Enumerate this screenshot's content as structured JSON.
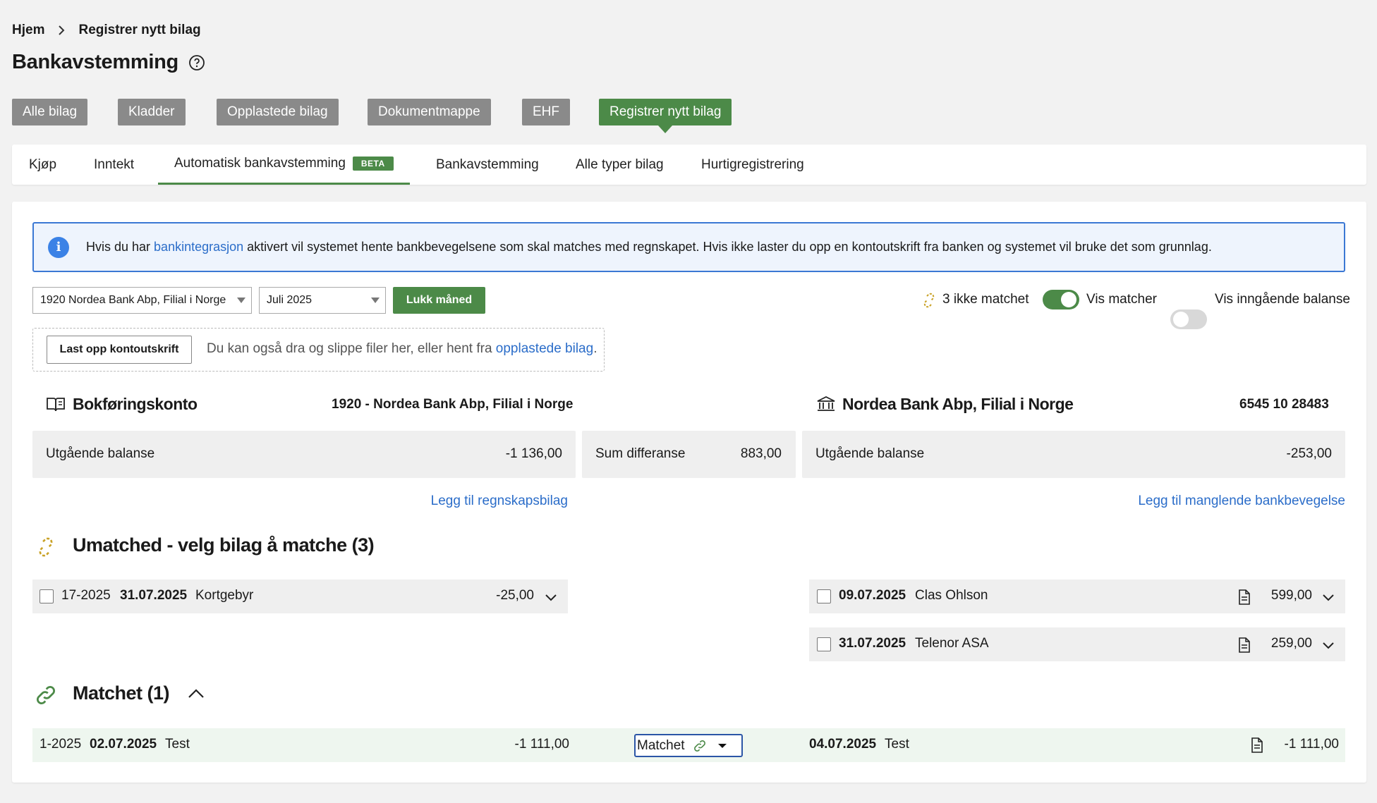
{
  "breadcrumb": {
    "home": "Hjem",
    "current": "Registrer nytt bilag"
  },
  "page_title": "Bankavstemming",
  "topnav": [
    "Alle bilag",
    "Kladder",
    "Opplastede bilag",
    "Dokumentmappe",
    "EHF",
    "Registrer nytt bilag"
  ],
  "tabs": {
    "kjop": "Kjøp",
    "inntekt": "Inntekt",
    "auto": "Automatisk bankavstemming",
    "beta": "BETA",
    "bank": "Bankavstemming",
    "alle": "Alle typer bilag",
    "hurtig": "Hurtigregistrering"
  },
  "info": {
    "before": "Hvis du har ",
    "link": "bankintegrasjon",
    "after": " aktivert vil systemet hente bankbevegelsene som skal matches med regnskapet. Hvis ikke laster du opp en kontoutskrift fra banken og systemet vil bruke det som grunnlag."
  },
  "controls": {
    "account_select": "1920 Nordea Bank Abp, Filial i Norge",
    "month_select": "Juli 2025",
    "close_month": "Lukk måned",
    "unmatched_count": "3 ikke matchet",
    "show_matches": "Vis matcher",
    "show_opening": "Vis inngående balanse"
  },
  "upload": {
    "button": "Last opp kontoutskrift",
    "text": "Du kan også dra og slippe filer her, eller hent fra",
    "link": "opplastede bilag",
    "period": "."
  },
  "ledger": {
    "title": "Bokføringskonto",
    "account": "1920 - Nordea Bank Abp, Filial i Norge",
    "balance_label": "Utgående balanse",
    "balance_value": "-1 136,00",
    "add_link": "Legg til regnskapsbilag"
  },
  "difference": {
    "label": "Sum differanse",
    "value": "883,00"
  },
  "bank": {
    "title": "Nordea Bank Abp, Filial i Norge",
    "account": "6545 10 28483",
    "balance_label": "Utgående balanse",
    "balance_value": "-253,00",
    "add_link": "Legg til manglende bankbevegelse"
  },
  "unmatched": {
    "title": "Umatched - velg bilag å matche (3)",
    "left": [
      {
        "voucher": "17-2025",
        "date": "31.07.2025",
        "text": "Kortgebyr",
        "amount": "-25,00"
      }
    ],
    "right": [
      {
        "date": "09.07.2025",
        "text": "Clas Ohlson",
        "amount": "599,00"
      },
      {
        "date": "31.07.2025",
        "text": "Telenor ASA",
        "amount": "259,00"
      }
    ]
  },
  "matched": {
    "title": "Matchet (1)",
    "rows": [
      {
        "voucher": "1-2025",
        "date": "02.07.2025",
        "text": "Test",
        "amount": "-1 111,00",
        "status": "Matchet",
        "bank_date": "04.07.2025",
        "bank_text": "Test",
        "bank_amount": "-1 111,00"
      }
    ]
  },
  "colors": {
    "accent_green": "#4c8a48",
    "link_blue": "#2b6dc9",
    "gray_button": "#8a8a8a",
    "warning_gold": "#c9a227"
  }
}
